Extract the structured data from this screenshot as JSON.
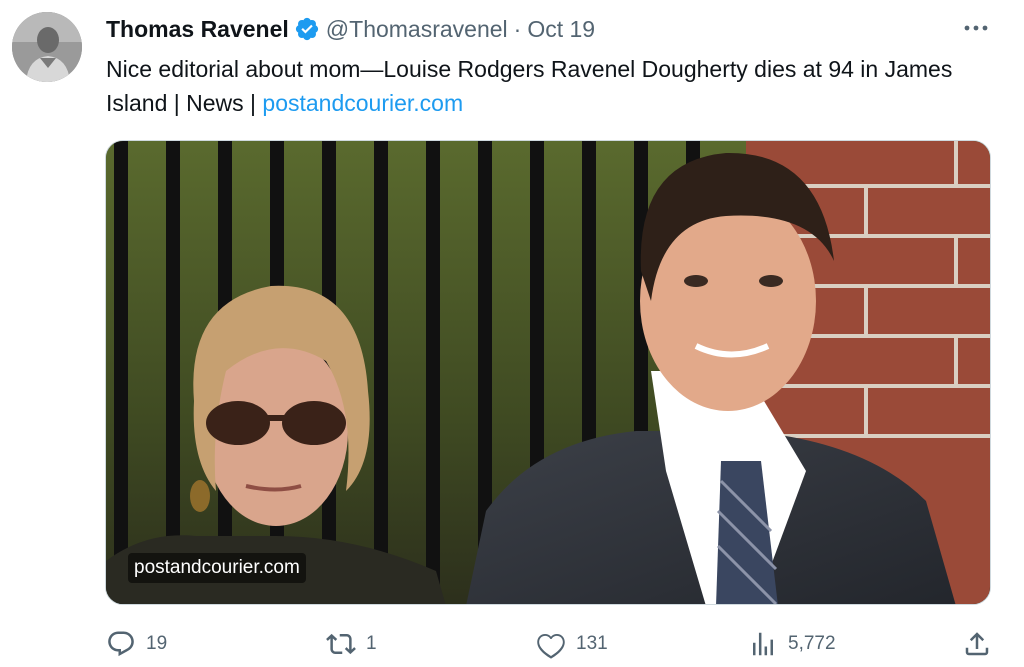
{
  "author": {
    "name": "Thomas Ravenel",
    "handle": "@Thomasravenel",
    "separator": "·",
    "date": "Oct 19",
    "avatar_icon": "profile-photo",
    "verified_icon": "verified-badge-icon"
  },
  "tweet": {
    "text_plain": "Nice editorial about mom—Louise Rodgers Ravenel Dougherty dies at 94 in James Island | News | ",
    "link_text": "postandcourier.com"
  },
  "media": {
    "caption": "postandcourier.com"
  },
  "actions": {
    "reply_count": "19",
    "retweet_count": "1",
    "like_count": "131",
    "views_count": "5,772"
  },
  "colors": {
    "accent": "#1d9bf0",
    "secondary_text": "#536471",
    "primary_text": "#0f1419"
  }
}
